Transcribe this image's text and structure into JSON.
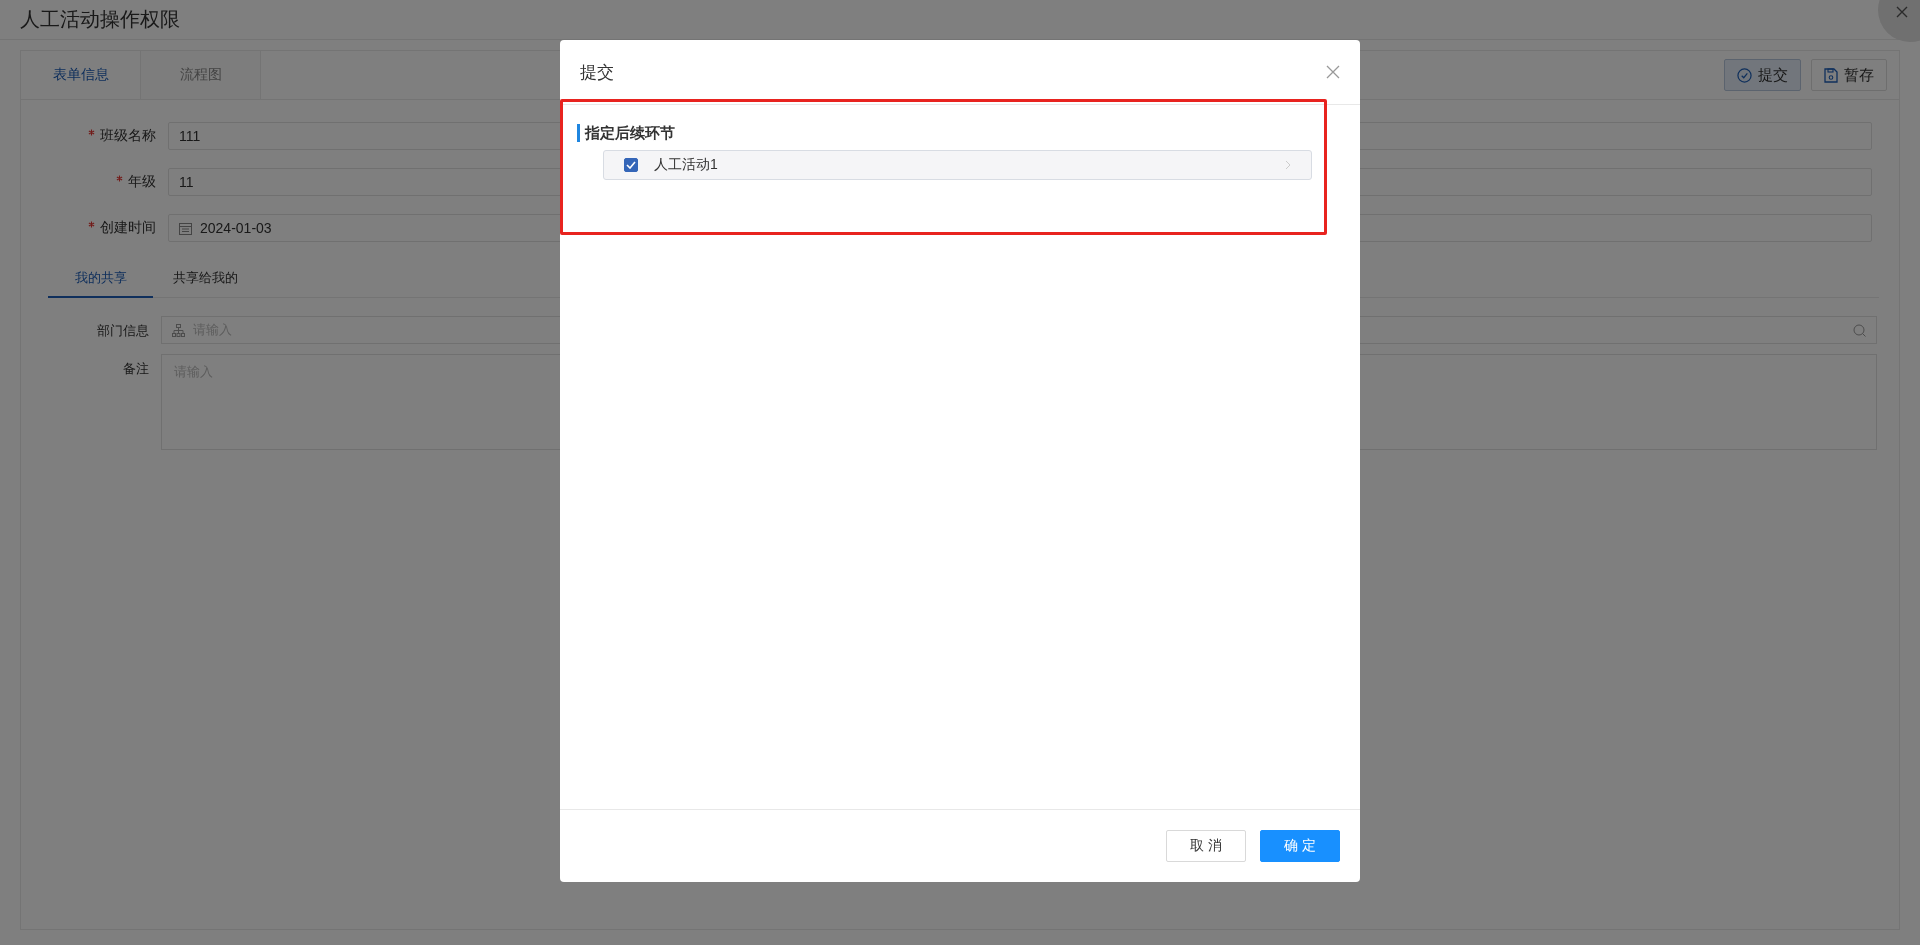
{
  "page": {
    "title": "人工活动操作权限",
    "tabs": [
      {
        "label": "表单信息",
        "selected": true
      },
      {
        "label": "流程图",
        "selected": false
      }
    ],
    "actions": [
      {
        "label": "提交",
        "kind": "check",
        "focused": true
      },
      {
        "label": "暂存",
        "kind": "save",
        "focused": false
      }
    ],
    "fields": [
      {
        "label": "班级名称",
        "required": true,
        "value": "111",
        "kind": "text"
      },
      {
        "label": "年级",
        "required": true,
        "value": "11",
        "kind": "text"
      },
      {
        "label": "创建时间",
        "required": true,
        "value": "2024-01-03",
        "kind": "date"
      }
    ],
    "subtabs": [
      {
        "label": "我的共享",
        "selected": true
      },
      {
        "label": "共享给我的",
        "selected": false
      }
    ],
    "extra_fields": [
      {
        "label": "部门信息",
        "placeholder": "请输入",
        "kind": "tree-select"
      },
      {
        "label": "备注",
        "placeholder": "请输入",
        "kind": "textarea"
      }
    ]
  },
  "dialog": {
    "title": "提交",
    "section": "指定后续环节",
    "options": [
      {
        "label": "人工活动1",
        "checked": true
      }
    ],
    "buttons": [
      {
        "label": "取 消",
        "kind": "default"
      },
      {
        "label": "确 定",
        "kind": "primary"
      }
    ]
  }
}
